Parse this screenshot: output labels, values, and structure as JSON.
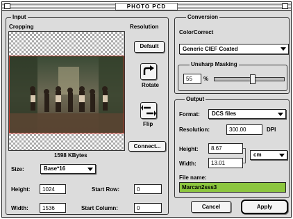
{
  "window": {
    "title": "PHOTO PCD"
  },
  "input": {
    "legend": "Input",
    "cropping_label": "Cropping",
    "resolution_label": "Resolution",
    "default_button": "Default",
    "rotate_label": "Rotate",
    "flip_label": "Flip",
    "connect_button": "Connect...",
    "file_size": "1598 KBytes",
    "size_label": "Size:",
    "size_value": "Base*16",
    "height_label": "Height:",
    "height_value": "1024",
    "width_label": "Width:",
    "width_value": "1536",
    "start_row_label": "Start Row:",
    "start_row_value": "0",
    "start_column_label": "Start Column:",
    "start_column_value": "0"
  },
  "conversion": {
    "legend": "Conversion",
    "colorspace_label": "ColorCorrect",
    "colorspace_value": "Generic CIEF Coated",
    "unsharp_legend": "Unsharp Masking",
    "unsharp_value": "55",
    "unsharp_unit": "%",
    "unsharp_level": 0.55
  },
  "output": {
    "legend": "Output",
    "format_label": "Format:",
    "format_value": "DCS files",
    "resolution_label": "Resolution:",
    "resolution_value": "300.00",
    "resolution_unit": "DPI",
    "height_label": "Height:",
    "height_value": "8.67",
    "width_label": "Width:",
    "width_value": "13.01",
    "unit_value": "cm",
    "filename_label": "File name:",
    "filename_value": "Marcan2sss3"
  },
  "buttons": {
    "cancel": "Cancel",
    "apply": "Apply"
  },
  "colors": {
    "filename_highlight": "#8cc63f",
    "selection_border": "#c0392b"
  }
}
